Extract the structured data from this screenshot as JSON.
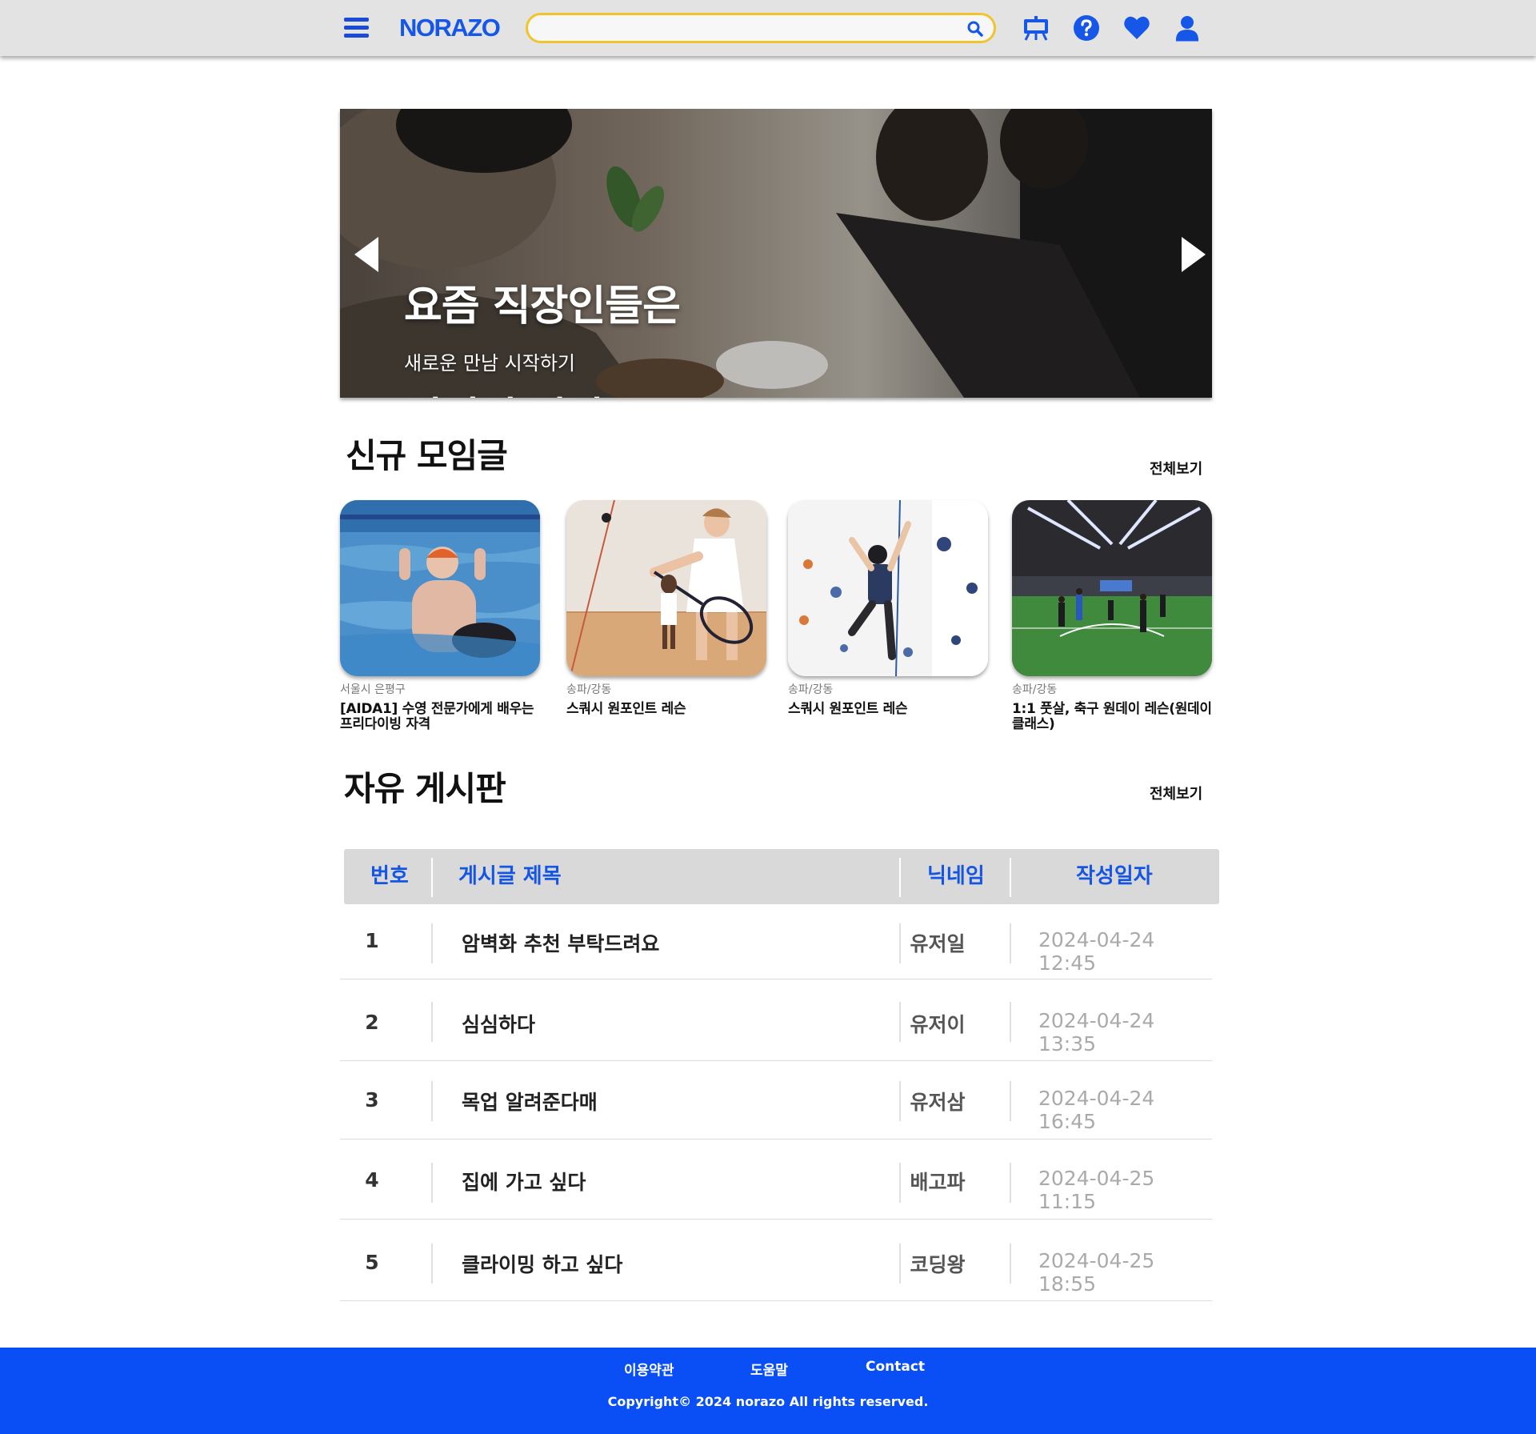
{
  "header": {
    "logo": "NORAZO",
    "search_placeholder": "",
    "icons": [
      "menu-icon",
      "search-icon",
      "board-icon",
      "help-icon",
      "heart-icon",
      "user-icon"
    ],
    "brand_color": "#1657e8",
    "search_border_color": "#f1c42b"
  },
  "hero": {
    "title_line1": "요즘 직장인들은",
    "title_line2": "여기서 만나요!",
    "subtitle": "새로운 만남 시작하기"
  },
  "new_meetings": {
    "title": "신규 모임글",
    "view_all": "전체보기",
    "cards": [
      {
        "location": "서울시 은평구",
        "title": "[AIDA1] 수영 전문가에게 배우는 프리다이빙 자격",
        "image": "swimming"
      },
      {
        "location": "송파/강동",
        "title": "스쿼시 원포인트 레슨",
        "image": "squash"
      },
      {
        "location": "송파/강동",
        "title": "스쿼시 원포인트 레슨",
        "image": "climbing"
      },
      {
        "location": "송파/강동",
        "title": "1:1 풋살, 축구 원데이 레슨(원데이 클래스)",
        "image": "futsal"
      }
    ]
  },
  "free_board": {
    "title": "자유 게시판",
    "view_all": "전체보기",
    "columns": {
      "no": "번호",
      "title": "게시글 제목",
      "nickname": "닉네임",
      "date": "작성일자"
    },
    "rows": [
      {
        "no": "1",
        "title": "암벽화 추천 부탁드려요",
        "nickname": "유저일",
        "date": "2024-04-24 12:45"
      },
      {
        "no": "2",
        "title": "심심하다",
        "nickname": "유저이",
        "date": "2024-04-24 13:35"
      },
      {
        "no": "3",
        "title": "목업 알려준다매",
        "nickname": "유저삼",
        "date": "2024-04-24 16:45"
      },
      {
        "no": "4",
        "title": "집에 가고 싶다",
        "nickname": "배고파",
        "date": "2024-04-25 11:15"
      },
      {
        "no": "5",
        "title": "클라이밍 하고 싶다",
        "nickname": "코딩왕",
        "date": "2024-04-25 18:55"
      }
    ]
  },
  "footer": {
    "links": [
      "이용약관",
      "도움말",
      "Contact"
    ],
    "copyright": "Copyright© 2024 norazo All rights reserved.",
    "background_color": "#0a4ff5"
  }
}
